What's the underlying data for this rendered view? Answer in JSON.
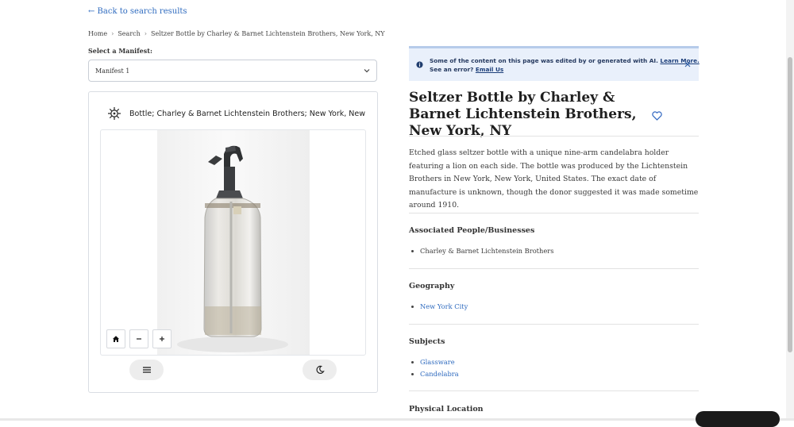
{
  "nav": {
    "back_link": "← Back to search results"
  },
  "breadcrumb": {
    "items": [
      "Home",
      "Search",
      "Seltzer Bottle by Charley & Barnet Lichtenstein Brothers, New York, NY"
    ],
    "separator": "›"
  },
  "manifest": {
    "label": "Select a Manifest:",
    "selected": "Manifest 1"
  },
  "viewer": {
    "title": "Bottle; Charley & Barnet Lichtenstein Brothers; New York, New Yo...",
    "controls": {
      "home_icon": "home-icon",
      "zoom_out_icon": "minus-icon",
      "zoom_in_icon": "plus-icon",
      "menu_icon": "menu-icon",
      "dark_mode_icon": "moon-icon"
    }
  },
  "notice": {
    "line1": "Some of the content on this page was edited by or generated with AI.",
    "learn_more": "Learn More.",
    "line2": "See an error?",
    "email_link": "Email Us"
  },
  "item": {
    "title": "Seltzer Bottle by Charley & Barnet Lichtenstein Brothers, New York, NY",
    "description": "Etched glass seltzer bottle with a unique nine-arm candelabra holder featuring a lion on each side. The bottle was produced by the Lichtenstein Brothers in New York, New York, United States. The exact date of manufacture is unknown, though the donor suggested it was made sometime around 1910."
  },
  "sections": {
    "people": {
      "heading": "Associated People/Businesses",
      "items": [
        "Charley & Barnet Lichtenstein Brothers"
      ]
    },
    "geography": {
      "heading": "Geography",
      "items": [
        "New York City"
      ]
    },
    "subjects": {
      "heading": "Subjects",
      "items": [
        "Glassware",
        "Candelabra"
      ]
    },
    "location": {
      "heading": "Physical Location"
    }
  },
  "colors": {
    "link": "#2f6bbf",
    "notice_bg": "#e9f0fb",
    "notice_border": "#b6cbea"
  }
}
